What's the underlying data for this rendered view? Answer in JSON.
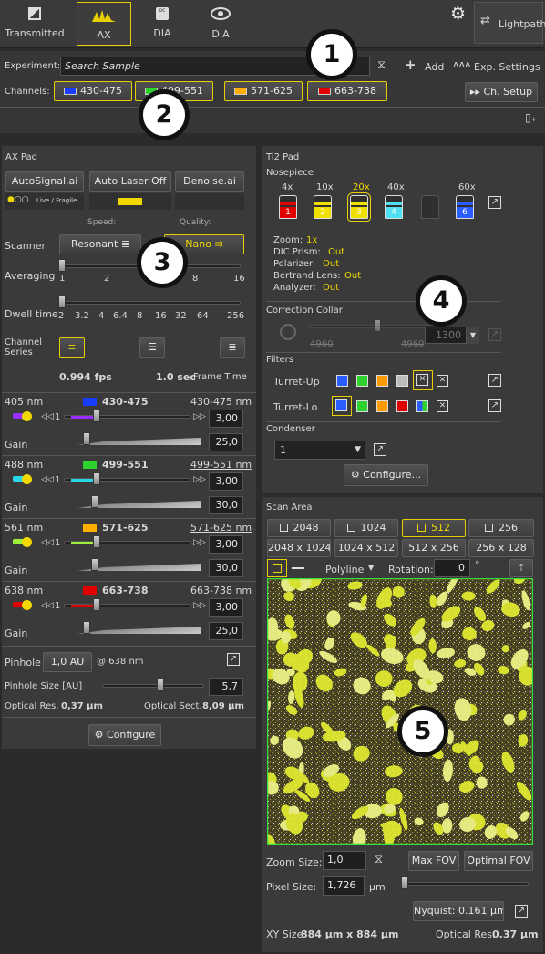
{
  "top": {
    "tabs": [
      {
        "label": "Transmitted"
      },
      {
        "label": "AX"
      },
      {
        "label": "DIA"
      },
      {
        "label": "DIA"
      }
    ],
    "lightpath": "Lightpath"
  },
  "experiment": {
    "label": "Experiment:",
    "placeholder": "Search Sample",
    "add": "Add",
    "exp_settings": "Exp. Settings"
  },
  "channels": {
    "label": "Channels:",
    "items": [
      {
        "name": "430-475",
        "color": "#1a3cff"
      },
      {
        "name": "499-551",
        "color": "#2fd12f"
      },
      {
        "name": "571-625",
        "color": "#ffae00"
      },
      {
        "name": "663-738",
        "color": "#e00000"
      }
    ],
    "ch_setup": "Ch. Setup"
  },
  "axpad": {
    "title": "AX Pad",
    "autosignal": "AutoSignal.ai",
    "autolaser": "Auto Laser Off",
    "denoise": "Denoise.ai",
    "livefragile": "Live / Fragile",
    "speed": "Speed:",
    "quality": "Quality:",
    "scanner": "Scanner",
    "resonant": "Resonant",
    "nano": "Nano",
    "averaging": "Averaging",
    "avg_ticks": [
      "1",
      "2",
      "8",
      "16"
    ],
    "dwell": "Dwell time",
    "dwell_ticks": [
      "2",
      "3.2",
      "4",
      "6.4",
      "8",
      "16",
      "32",
      "64",
      "256"
    ],
    "channel_series": "Channel Series",
    "fps": "0.994 fps",
    "frametime": "1.0 sec",
    "frametime_label": "Frame Time",
    "lasers": [
      {
        "nm": "405 nm",
        "color": "#1a3cff",
        "name": "430-475",
        "range": "430-475 nm",
        "power": "3,00",
        "gain": "25,0",
        "gain_label": "Gain",
        "dot": "#9a2dff",
        "step": "1",
        "laser_frac": 0.72,
        "gain_frac": 0.25
      },
      {
        "nm": "488 nm",
        "color": "#2fd12f",
        "name": "499-551",
        "range": "499-551 nm",
        "power": "3,00",
        "gain": "30,0",
        "gain_label": "Gain",
        "dot": "#28d8e8",
        "step": "1",
        "laser_frac": 0.72,
        "gain_frac": 0.3
      },
      {
        "nm": "561 nm",
        "color": "#ffae00",
        "name": "571-625",
        "range": "571-625 nm",
        "power": "3,00",
        "gain": "30,0",
        "gain_label": "Gain",
        "dot": "#9ef03a",
        "step": "1",
        "laser_frac": 0.72,
        "gain_frac": 0.3
      },
      {
        "nm": "638 nm",
        "color": "#e00000",
        "name": "663-738",
        "range": "663-738 nm",
        "power": "3,00",
        "gain": "25,0",
        "gain_label": "Gain",
        "dot": "#e00000",
        "step": "1",
        "laser_frac": 0.72,
        "gain_frac": 0.25
      }
    ],
    "pinhole": "Pinhole",
    "pinhole_val": "1,0 AU",
    "at": "@ 638 nm",
    "pinhole_size": "Pinhole Size [AU]",
    "pinhole_size_val": "5,7",
    "opt_res_label": "Optical Res.",
    "opt_res": "0,37 µm",
    "opt_sect_label": "Optical Sect.",
    "opt_sect": "8,09 µm",
    "configure": "Configure"
  },
  "ti2": {
    "title": "Ti2 Pad",
    "nosepiece": "Nosepiece",
    "objectives": [
      {
        "mag": "4x",
        "num": "1",
        "color": "#e00000"
      },
      {
        "mag": "10x",
        "num": "2",
        "color": "#f0e000"
      },
      {
        "mag": "20x",
        "num": "3",
        "color": "#f0e000"
      },
      {
        "mag": "40x",
        "num": "4",
        "color": "#4ee0f0"
      },
      {
        "mag": "",
        "num": "",
        "color": ""
      },
      {
        "mag": "60x",
        "num": "6",
        "color": "#2a5cff"
      }
    ],
    "status": [
      {
        "k": "Zoom:",
        "v": "1x"
      },
      {
        "k": "DIC Prism:",
        "v": "Out"
      },
      {
        "k": "Polarizer:",
        "v": "Out"
      },
      {
        "k": "Bertrand Lens:",
        "v": "Out"
      },
      {
        "k": "Analyzer:",
        "v": "Out"
      }
    ],
    "collar": "Correction Collar",
    "collar_min": "4960",
    "collar_max": "4960",
    "collar_val": "1300",
    "filters": "Filters",
    "turret_up": "Turret-Up",
    "turret_lo": "Turret-Lo",
    "condenser": "Condenser",
    "condenser_val": "1",
    "configure": "Configure..."
  },
  "scan": {
    "title": "Scan Area",
    "sizes": [
      "2048",
      "1024",
      "512",
      "256"
    ],
    "rects": [
      "2048 x 1024",
      "1024 x 512",
      "512 x 256",
      "256 x 128"
    ],
    "polyline": "Polyline",
    "rotation": "Rotation:",
    "rotation_val": "0",
    "deg": "°",
    "zoom_label": "Zoom Size:",
    "zoom_val": "1,0",
    "max_fov": "Max FOV",
    "optimal_fov": "Optimal FOV",
    "pixel_label": "Pixel Size:",
    "pixel_val": "1,726",
    "pixel_unit": "µm",
    "nyquist": "Nyquist: 0.161 µm",
    "xy_label": "XY Size",
    "xy_val": "884 µm x 884 µm",
    "optres_label": "Optical Res.",
    "optres_val": "0.37 µm"
  },
  "callouts": [
    "1",
    "2",
    "3",
    "4",
    "5"
  ]
}
